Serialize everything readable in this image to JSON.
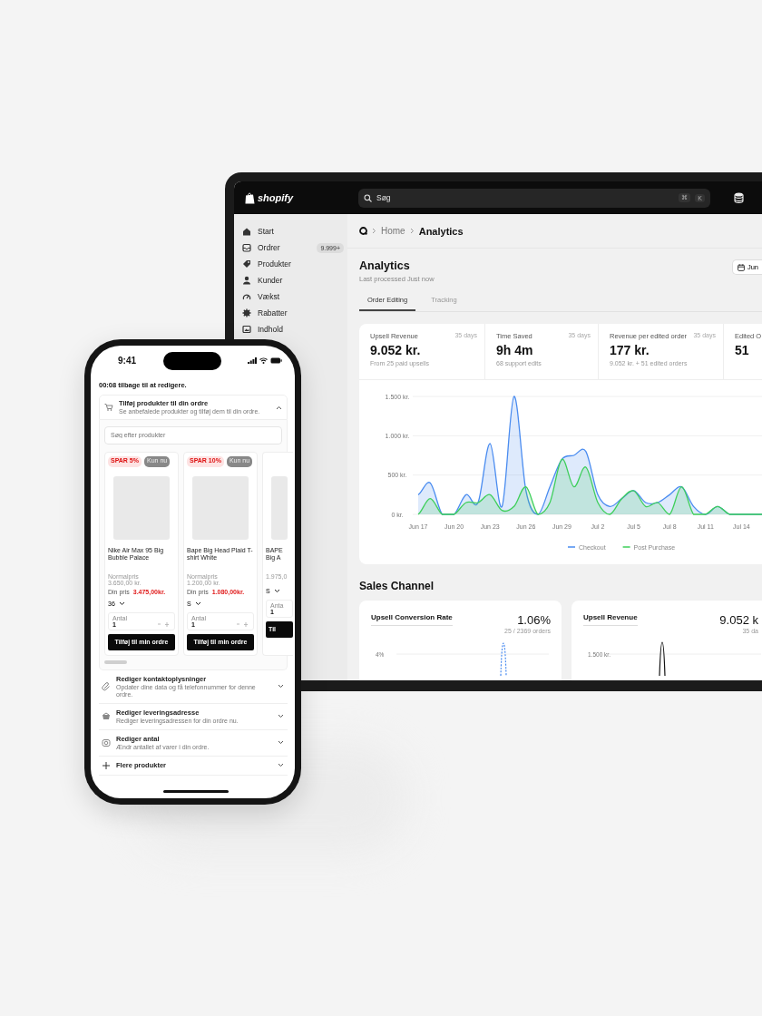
{
  "laptop": {
    "topbar": {
      "logo": "shopify",
      "search": {
        "value": "Søg"
      },
      "shortcut": [
        "⌘",
        "K"
      ]
    },
    "sidebar": {
      "items": [
        {
          "label": "Start"
        },
        {
          "label": "Ordrer",
          "count": "9.999+"
        },
        {
          "label": "Produkter"
        },
        {
          "label": "Kunder"
        },
        {
          "label": "Vækst"
        },
        {
          "label": "Rabatter"
        },
        {
          "label": "Indhold"
        }
      ]
    },
    "breadcrumb": [
      {
        "label": "Home",
        "current": false
      },
      {
        "label": "Analytics",
        "current": true
      }
    ],
    "page": {
      "title": "Analytics",
      "subtitle": "Last processed Just now",
      "date_button": "Jun"
    },
    "tabs": [
      {
        "label": "Order Editing",
        "selected": true
      },
      {
        "label": "Tracking",
        "selected": false
      }
    ],
    "metrics": [
      {
        "label": "Upsell Revenue",
        "period": "35 days",
        "value": "9.052 kr.",
        "note": "From 25 paid upsells"
      },
      {
        "label": "Time Saved",
        "period": "35 days",
        "value": "9h 4m",
        "note": "68 support edits"
      },
      {
        "label": "Revenue per edited order",
        "period": "35 days",
        "value": "177 kr.",
        "note": "9.052 kr. + 51 edited orders"
      },
      {
        "label": "Edited O",
        "value": "51"
      }
    ],
    "chart_data": {
      "type": "area",
      "legend": "bottom",
      "categories": [
        "Jun 17",
        null,
        null,
        "Jun 20",
        null,
        null,
        "Jun 23",
        null,
        null,
        "Jun 26",
        null,
        null,
        "Jun 29",
        null,
        null,
        "Jul 2",
        null,
        null,
        "Jul 5",
        null,
        null,
        "Jul 8",
        null,
        null,
        "Jul 11",
        null,
        null,
        "Jul 14",
        null,
        null
      ],
      "series": [
        {
          "name": "Checkout",
          "color": "#4a8cf0",
          "values": [
            250,
            400,
            0,
            0,
            250,
            150,
            900,
            100,
            1500,
            300,
            0,
            350,
            700,
            750,
            800,
            250,
            100,
            200,
            300,
            150,
            150,
            250,
            350,
            100,
            0,
            100,
            0,
            0,
            0,
            0
          ]
        },
        {
          "name": "Post Purchase",
          "color": "#3ecf5a",
          "values": [
            0,
            200,
            0,
            0,
            150,
            150,
            250,
            50,
            100,
            350,
            0,
            150,
            700,
            350,
            600,
            150,
            0,
            200,
            300,
            100,
            150,
            0,
            350,
            0,
            0,
            100,
            0,
            0,
            0,
            0
          ]
        }
      ],
      "ylim": [
        0,
        1500
      ],
      "yticks": [
        {
          "value": 0,
          "label": "0 kr."
        },
        {
          "value": 500,
          "label": "500 kr."
        },
        {
          "value": 1000,
          "label": "1.000 kr."
        },
        {
          "value": 1500,
          "label": "1.500 kr."
        }
      ],
      "grid": true
    },
    "sales_channel": {
      "title": "Sales Channel",
      "cards": [
        {
          "title": "Upsell Conversion Rate",
          "value": "1.06%",
          "note": "25 / 2369 orders",
          "tick": "4%",
          "kind": "dashed"
        },
        {
          "title": "Upsell Revenue",
          "value": "9.052 k",
          "note": "35 da",
          "tick": "1.500 kr.",
          "kind": "solid"
        }
      ]
    }
  },
  "phone": {
    "time": "9:41",
    "timer": "00:08 tilbage til at redigere.",
    "search": {
      "placeholder": "Søg efter produkter"
    },
    "products": [
      {
        "badges": [
          {
            "label": "SPAR 5%",
            "kind": "discount"
          },
          {
            "label": "Kun nu",
            "kind": "tag"
          }
        ],
        "name": "Nike Air Max 95 Big Bubble Palace",
        "normal_label": "Normalpris",
        "normal_price": "3.650,00 kr.",
        "price_label": "Din pris",
        "price": "3.475,00kr.",
        "size": "36",
        "qty_label": "Antal",
        "qty": "1",
        "button": "Tilføj til min ordre"
      },
      {
        "badges": [
          {
            "label": "SPAR 10%",
            "kind": "discount"
          },
          {
            "label": "Kun nu",
            "kind": "tag"
          }
        ],
        "name": "Bape Big Head Plaid T-shirt White",
        "normal_label": "Normalpris",
        "normal_price": "1.200,00 kr.",
        "price_label": "Din pris",
        "price": "1.080,00kr.",
        "size": "S",
        "qty_label": "Antal",
        "qty": "1",
        "button": "Tilføj til min ordre"
      },
      {
        "name": "BAPE Big A",
        "normal_price": "1.975,0",
        "size": "S",
        "qty_label": "Anta",
        "qty": "1",
        "button": "Til"
      }
    ],
    "sections": [
      {
        "title": "Tilføj produkter til din ordre",
        "subtitle": "Se anbefalede produkter og tilføj dem til din ordre.",
        "expanded": true
      },
      {
        "title": "Rediger kontaktoplysninger",
        "subtitle": "Opdater dine data og få telefonnummer for denne ordre.",
        "expanded": false
      },
      {
        "title": "Rediger leveringsadresse",
        "subtitle": "Rediger leveringsadressen for din ordre nu.",
        "expanded": false
      },
      {
        "title": "Rediger antal",
        "subtitle": "Ændr antallet af varer i din ordre.",
        "expanded": false
      },
      {
        "title": "Flere produkter",
        "expanded": false
      }
    ]
  }
}
